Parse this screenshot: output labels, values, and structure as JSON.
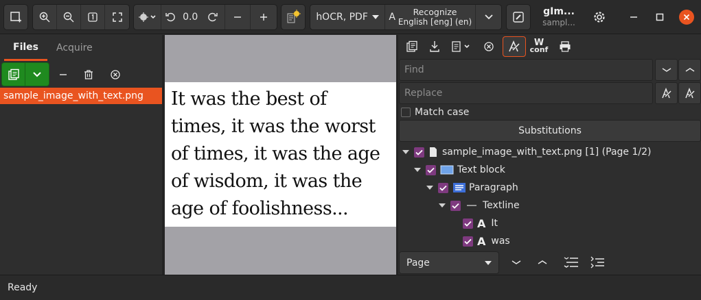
{
  "header": {
    "zoom_value": "0.0",
    "output_format": "hOCR, PDF",
    "recognize_label": "Recognize",
    "recognize_language": "English [eng] (en)",
    "app_title": "gIm...",
    "app_subtitle": "sampl..."
  },
  "left_pane": {
    "tabs": [
      "Files",
      "Acquire"
    ],
    "active_tab": "Files",
    "files": [
      "sample_image_with_text.png"
    ]
  },
  "document": {
    "lines": [
      "It was the best of",
      "times, it was the worst",
      "of times, it was the age",
      "of wisdom, it was the",
      "age of foolishness..."
    ]
  },
  "right_pane": {
    "wconf_label_top": "W",
    "wconf_label_bottom": "conf",
    "find_placeholder": "Find",
    "replace_placeholder": "Replace",
    "match_case_label": "Match case",
    "substitutions_label": "Substitutions",
    "tree": [
      {
        "label": "sample_image_with_text.png [1] (Page 1/2)",
        "type": "page"
      },
      {
        "label": "Text block",
        "type": "block"
      },
      {
        "label": "Paragraph",
        "type": "paragraph"
      },
      {
        "label": "Textline",
        "type": "line"
      },
      {
        "label": "It",
        "type": "word"
      },
      {
        "label": "was",
        "type": "word"
      }
    ],
    "navigate_mode": "Page"
  },
  "status": {
    "text": "Ready"
  },
  "colors": {
    "accent": "#e95420",
    "checkbox": "#7e3a7f",
    "green": "#1f8a1f"
  }
}
